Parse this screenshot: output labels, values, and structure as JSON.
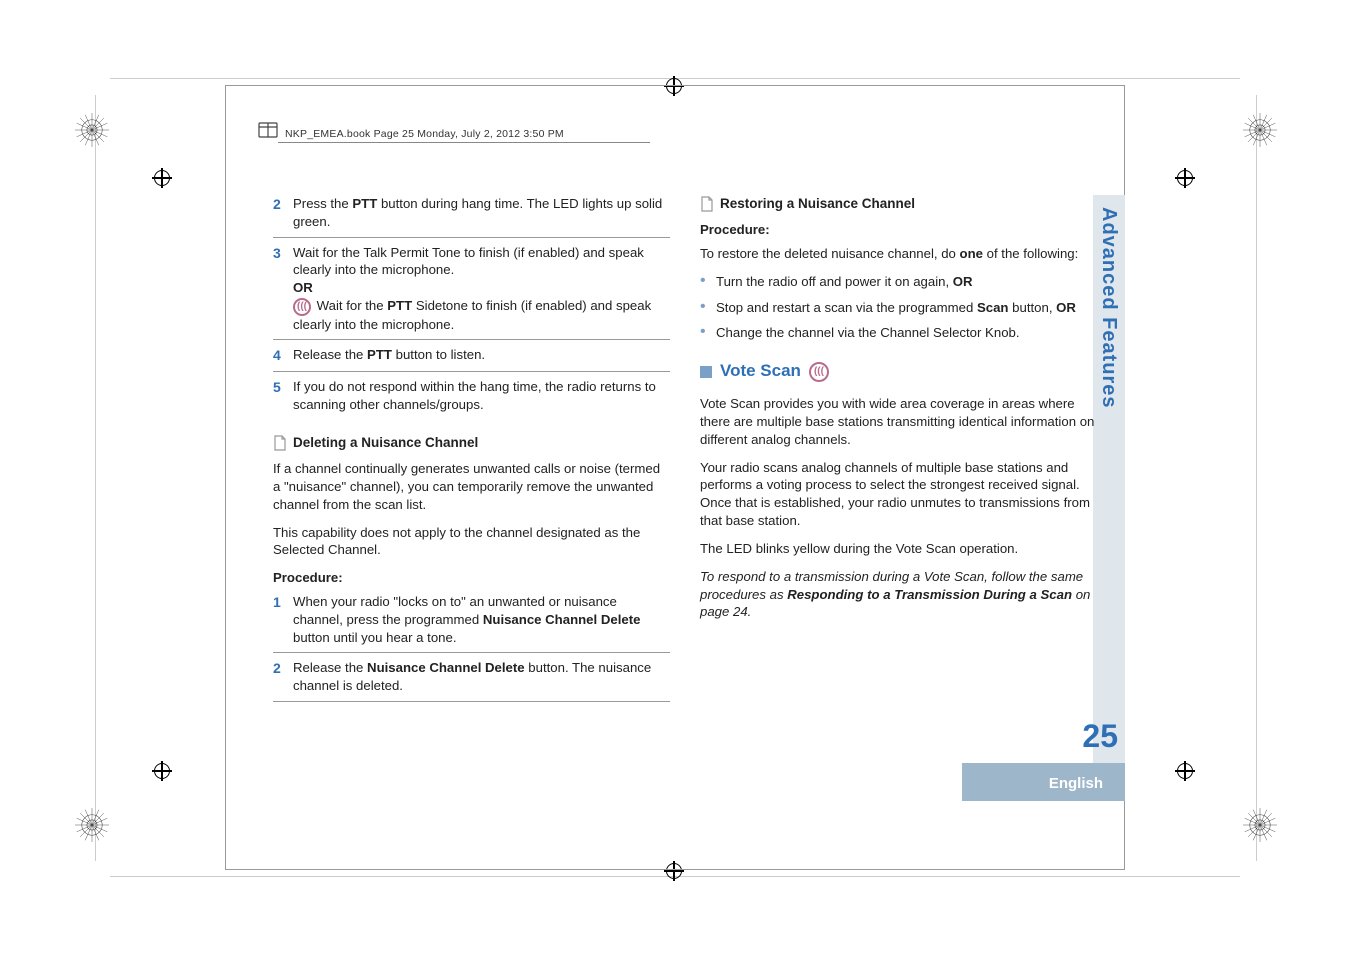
{
  "meta_line": "NKP_EMEA.book  Page 25  Monday, July 2, 2012  3:50 PM",
  "side_tab": "Advanced Features",
  "page_number": "25",
  "language": "English",
  "left": {
    "steps": [
      {
        "n": "2",
        "html": "Press the <b>PTT</b> button during hang time. The LED lights up solid green."
      },
      {
        "n": "3",
        "html": "Wait for the Talk Permit Tone to finish (if enabled) and speak clearly into the microphone.<br><b>OR</b><br><span class='m-icon' data-name='analog-mode-icon' data-interactable='false'>(((</span> Wait for the <b>PTT</b> Sidetone to finish (if enabled) and speak clearly into the microphone."
      },
      {
        "n": "4",
        "html": "Release the <b>PTT</b> button to listen."
      },
      {
        "n": "5",
        "html": "If you do not respond within the hang time, the radio returns to scanning other channels/groups."
      }
    ],
    "del_heading": "Deleting a Nuisance Channel",
    "del_para1": "If a channel continually generates unwanted calls or noise (termed a \"nuisance\" channel), you can temporarily remove the unwanted channel from the scan list.",
    "del_para2": "This capability does not apply to the channel designated as the Selected Channel.",
    "proc": "Procedure:",
    "del_steps": [
      {
        "n": "1",
        "html": "When your radio \"locks on to\" an unwanted or nuisance channel, press the programmed <b>Nuisance Channel Delete</b> button until you hear a tone."
      },
      {
        "n": "2",
        "html": "Release the <b>Nuisance Channel Delete</b> button. The nuisance channel is deleted."
      }
    ]
  },
  "right": {
    "rest_heading": "Restoring a Nuisance Channel",
    "proc": "Procedure:",
    "rest_intro": "To restore the deleted nuisance channel, do <b>one</b> of the following:",
    "rest_bullets": [
      "Turn the radio off and power it on again, <b>OR</b>",
      "Stop and restart a scan via the programmed <b>Scan</b> button, <b>OR</b>",
      "Change the channel via the Channel Selector Knob."
    ],
    "vote_heading": "Vote Scan",
    "vote_p1": "Vote Scan provides you with wide area coverage in areas where there are multiple base stations transmitting identical information on different analog channels.",
    "vote_p2": "Your radio scans analog channels of multiple base stations and performs a voting process to select the strongest received signal. Once that is established, your radio unmutes to transmissions from that base station.",
    "vote_p3": "The LED blinks yellow during the Vote Scan operation.",
    "vote_p4": "To respond to a transmission during a Vote Scan, follow the same procedures as <b>Responding to a Transmission During a Scan</b> on page 24."
  }
}
